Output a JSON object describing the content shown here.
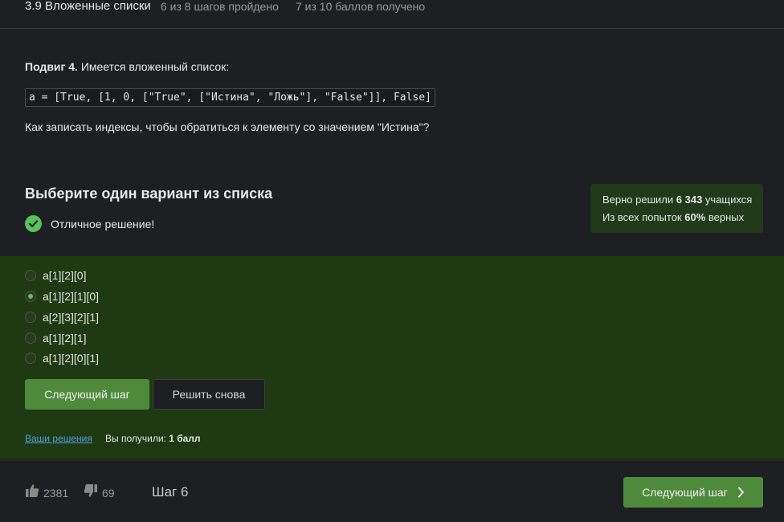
{
  "topbar": {
    "lesson": "3.9 Вложенные списки",
    "steps": "6 из 8 шагов пройдено",
    "points": "7 из 10 баллов  получено"
  },
  "task": {
    "title_bold": "Подвиг 4.",
    "title_rest": " Имеется вложенный список:",
    "code": "a = [True, [1, 0, [\"True\", [\"Истина\", \"Ложь\"], \"False\"]], False]",
    "question": "Как записать индексы, чтобы обратиться к элементу со значением \"Истина\"?"
  },
  "choose": {
    "title": "Выберите один вариант из списка",
    "success_text": "Отличное решение!"
  },
  "stats": {
    "line1_pre": "Верно решили ",
    "line1_num": "6 343",
    "line1_post": " учащихся",
    "line2_pre": "Из всех попыток ",
    "line2_num": "60%",
    "line2_post": " верных"
  },
  "options": [
    {
      "label": "a[1][2][0]",
      "selected": false
    },
    {
      "label": "a[1][2][1][0]",
      "selected": true
    },
    {
      "label": "a[2][3][2][1]",
      "selected": false
    },
    {
      "label": "a[1][2][1]",
      "selected": false
    },
    {
      "label": "a[1][2][0][1]",
      "selected": false
    }
  ],
  "actions": {
    "next_label": "Следующий шаг",
    "retry_label": "Решить снова",
    "solutions_link": "Ваши решения",
    "result_pre": "Вы получили: ",
    "result_value": "1 балл"
  },
  "footer": {
    "likes": "2381",
    "dislikes": "69",
    "step_label": "Шаг 6",
    "next_label": "Следующий шаг"
  },
  "colors": {
    "accent_green": "#4f8a3c",
    "success_green": "#57c35a",
    "answers_bg": "#1f3a12",
    "link_blue": "#4f9fe0"
  }
}
